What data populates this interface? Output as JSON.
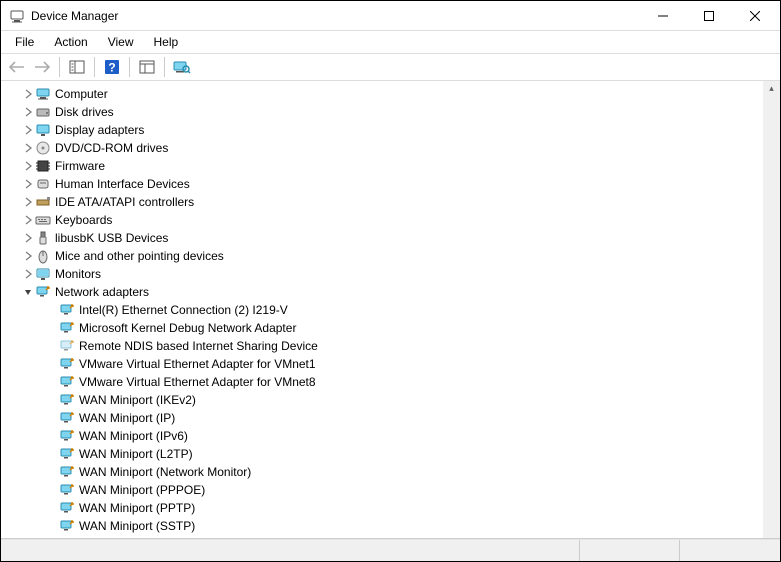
{
  "window": {
    "title": "Device Manager"
  },
  "menu": {
    "items": [
      "File",
      "Action",
      "View",
      "Help"
    ]
  },
  "toolbar": {
    "back": "Back",
    "forward": "Forward",
    "show_hide": "Show/Hide Console Tree",
    "help": "Help",
    "properties": "Properties",
    "scan": "Scan for hardware changes"
  },
  "tree": {
    "categories": [
      {
        "label": "Computer",
        "icon": "computer",
        "expanded": false
      },
      {
        "label": "Disk drives",
        "icon": "disk",
        "expanded": false
      },
      {
        "label": "Display adapters",
        "icon": "display",
        "expanded": false
      },
      {
        "label": "DVD/CD-ROM drives",
        "icon": "cdrom",
        "expanded": false
      },
      {
        "label": "Firmware",
        "icon": "firmware",
        "expanded": false
      },
      {
        "label": "Human Interface Devices",
        "icon": "hid",
        "expanded": false
      },
      {
        "label": "IDE ATA/ATAPI controllers",
        "icon": "ide",
        "expanded": false
      },
      {
        "label": "Keyboards",
        "icon": "keyboard",
        "expanded": false
      },
      {
        "label": "libusbK USB Devices",
        "icon": "usb",
        "expanded": false
      },
      {
        "label": "Mice and other pointing devices",
        "icon": "mouse",
        "expanded": false
      },
      {
        "label": "Monitors",
        "icon": "monitor",
        "expanded": false
      },
      {
        "label": "Network adapters",
        "icon": "network",
        "expanded": true,
        "children": [
          {
            "label": "Intel(R) Ethernet Connection (2) I219-V",
            "icon": "network"
          },
          {
            "label": "Microsoft Kernel Debug Network Adapter",
            "icon": "network"
          },
          {
            "label": "Remote NDIS based Internet Sharing Device",
            "icon": "network-light"
          },
          {
            "label": "VMware Virtual Ethernet Adapter for VMnet1",
            "icon": "network"
          },
          {
            "label": "VMware Virtual Ethernet Adapter for VMnet8",
            "icon": "network"
          },
          {
            "label": "WAN Miniport (IKEv2)",
            "icon": "network"
          },
          {
            "label": "WAN Miniport (IP)",
            "icon": "network"
          },
          {
            "label": "WAN Miniport (IPv6)",
            "icon": "network"
          },
          {
            "label": "WAN Miniport (L2TP)",
            "icon": "network"
          },
          {
            "label": "WAN Miniport (Network Monitor)",
            "icon": "network"
          },
          {
            "label": "WAN Miniport (PPPOE)",
            "icon": "network"
          },
          {
            "label": "WAN Miniport (PPTP)",
            "icon": "network"
          },
          {
            "label": "WAN Miniport (SSTP)",
            "icon": "network"
          }
        ]
      }
    ]
  }
}
